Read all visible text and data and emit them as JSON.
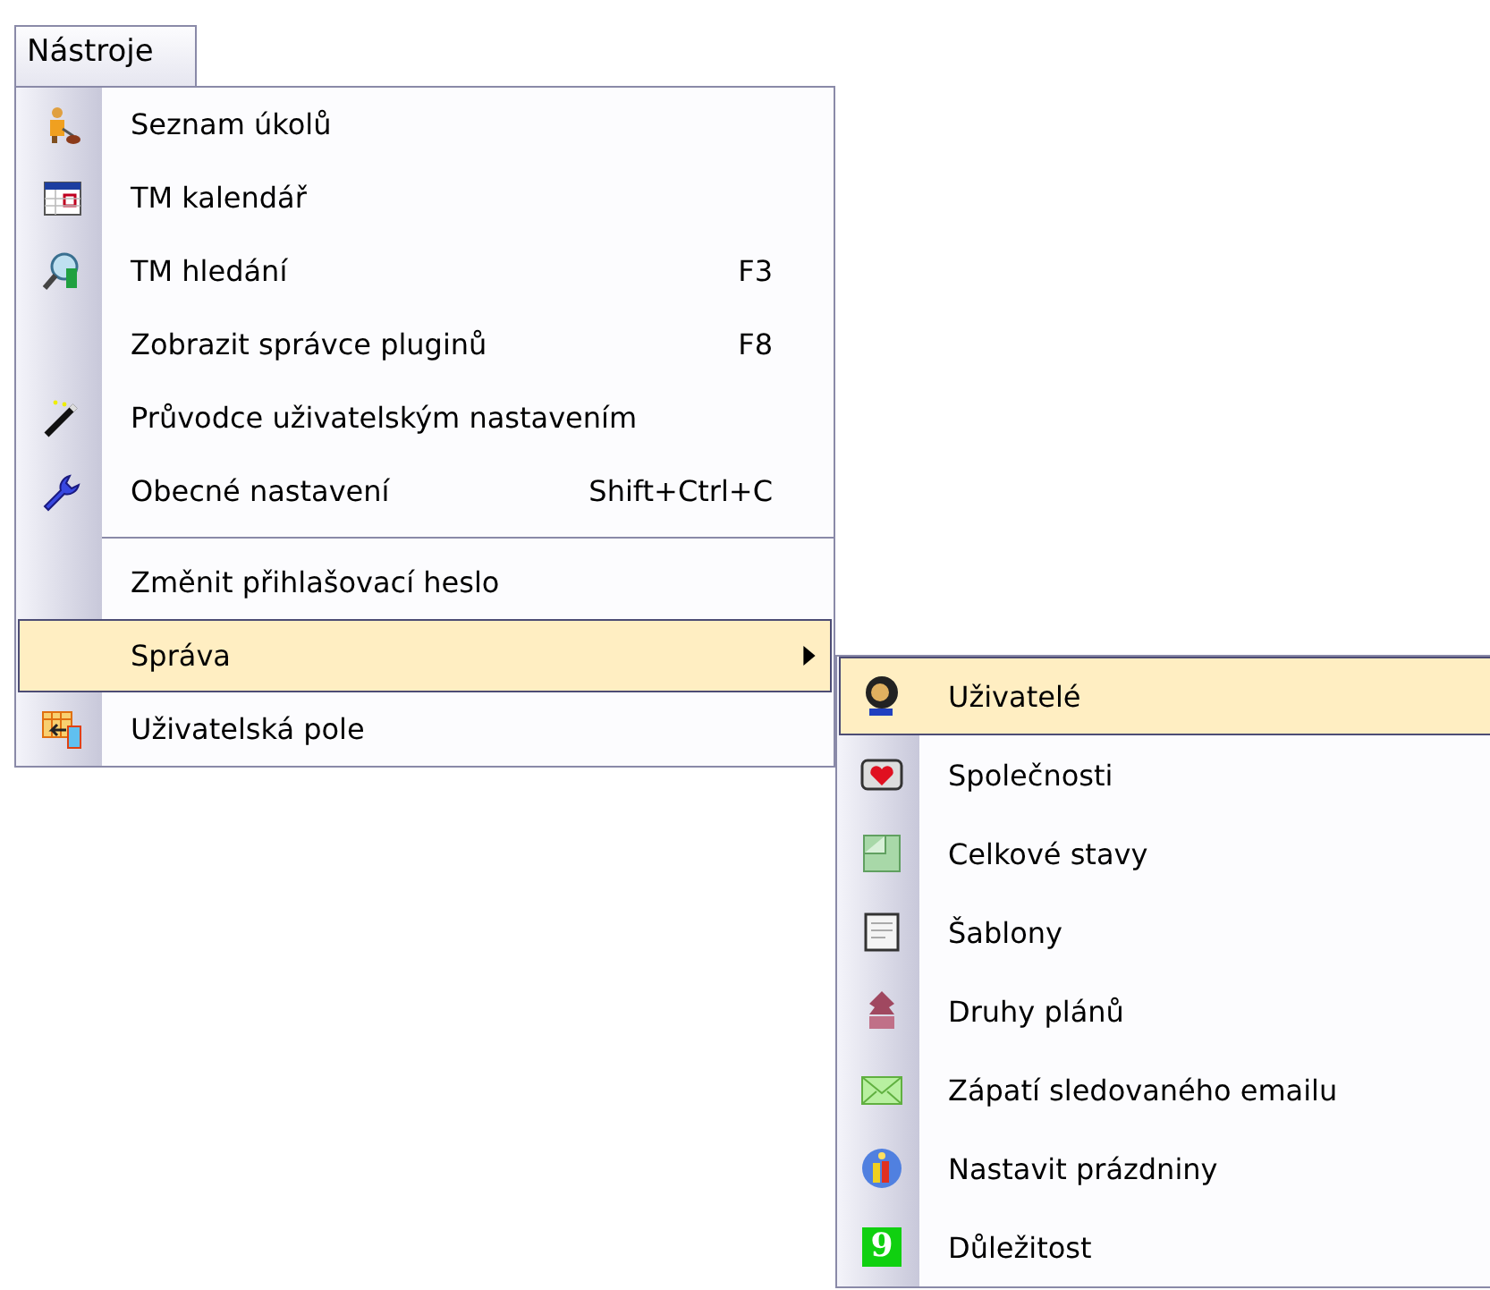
{
  "menu_bar": {
    "label": "Nástroje",
    "selected": true
  },
  "menu": {
    "items": [
      {
        "kind": "item",
        "label": "Seznam úkolů",
        "submenu": false,
        "selected": false
      },
      {
        "kind": "item",
        "label": "TM kalendář",
        "submenu": false,
        "selected": false
      },
      {
        "kind": "item",
        "label": "TM hledání",
        "shortcut": "F3",
        "submenu": false,
        "selected": false
      },
      {
        "kind": "item",
        "label": "Zobrazit správce pluginů",
        "shortcut": "F8",
        "submenu": false,
        "selected": false
      },
      {
        "kind": "item",
        "label": "Průvodce uživatelským nastavením",
        "submenu": false,
        "selected": false
      },
      {
        "kind": "item",
        "label": "Obecné nastavení",
        "shortcut": "Shift+Ctrl+C",
        "submenu": false,
        "selected": false
      },
      {
        "kind": "separator"
      },
      {
        "kind": "item",
        "label": "Změnit přihlašovací heslo",
        "submenu": false,
        "selected": false
      },
      {
        "kind": "item",
        "label": "Správa",
        "submenu": true,
        "selected": true
      },
      {
        "kind": "item",
        "label": "Uživatelská pole",
        "submenu": false,
        "selected": false
      }
    ]
  },
  "submenu": {
    "items": [
      {
        "kind": "item",
        "label": "Uživatelé",
        "selected": true
      },
      {
        "kind": "item",
        "label": "Společnosti",
        "selected": false
      },
      {
        "kind": "item",
        "label": "Celkové stavy",
        "selected": false
      },
      {
        "kind": "item",
        "label": "Šablony",
        "selected": false
      },
      {
        "kind": "item",
        "label": "Druhy plánů",
        "selected": false
      },
      {
        "kind": "item",
        "label": "Zápatí sledovaného emailu",
        "selected": false
      },
      {
        "kind": "item",
        "label": "Nastavit prázdniny",
        "selected": false
      },
      {
        "kind": "item",
        "label": "Důležitost",
        "icon_text": "9",
        "selected": false
      }
    ]
  }
}
